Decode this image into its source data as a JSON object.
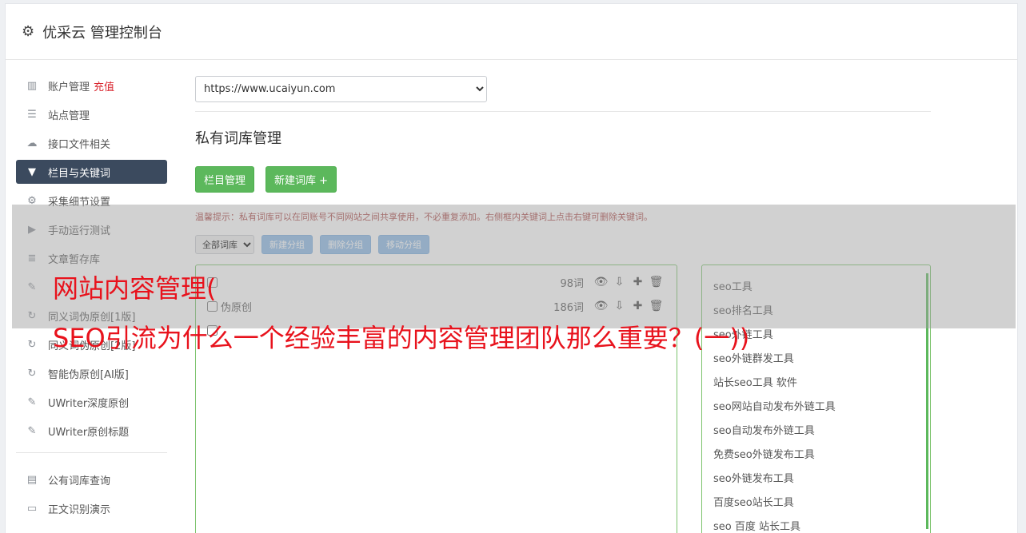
{
  "header": {
    "icon": "gear-icon",
    "title": "优采云 管理控制台"
  },
  "sidebar": {
    "items": [
      {
        "icon": "bar-chart-icon",
        "label": "账户管理",
        "extra": "充值"
      },
      {
        "icon": "server-icon",
        "label": "站点管理"
      },
      {
        "icon": "cloud-upload-icon",
        "label": "接口文件相关"
      },
      {
        "icon": "filter-icon",
        "label": "栏目与关键词",
        "active": true
      },
      {
        "icon": "cogs-icon",
        "label": "采集细节设置"
      },
      {
        "icon": "play-circle-icon",
        "label": "手动运行测试"
      },
      {
        "icon": "database-icon",
        "label": "文章暂存库"
      },
      {
        "icon": "edit-icon",
        "label": ""
      },
      {
        "icon": "refresh-icon",
        "label": "同义词伪原创[1版]"
      },
      {
        "icon": "refresh-icon",
        "label": "同义词伪原创[2版]"
      },
      {
        "icon": "refresh-icon",
        "label": "智能伪原创[AI版]"
      },
      {
        "icon": "edit-icon",
        "label": "UWriter深度原创"
      },
      {
        "icon": "edit-icon",
        "label": "UWriter原创标题"
      }
    ],
    "items2": [
      {
        "icon": "book-icon",
        "label": "公有词库查询"
      },
      {
        "icon": "monitor-icon",
        "label": "正文识别演示"
      }
    ]
  },
  "main": {
    "site_select": "https://www.ucaiyun.com",
    "section_title": "私有词库管理",
    "btn_columns": "栏目管理",
    "btn_new": "新建词库 +",
    "tip": "温馨提示：私有词库可以在同账号不同网站之间共享使用，不必重复添加。右侧框内关键词上点击右键可删除关键词。",
    "filter_select": "全部词库",
    "btn_add_group": "新建分组",
    "btn_del_group": "删除分组",
    "btn_move_group": "移动分组",
    "groups": [
      {
        "name": "",
        "count": "98词"
      },
      {
        "name": "伪原创",
        "count": "186词"
      },
      {
        "name": "",
        "count": ""
      }
    ],
    "keywords": [
      "seo工具",
      "seo排名工具",
      "seo外链工具",
      "seo外链群发工具",
      "站长seo工具 软件",
      "seo网站自动发布外链工具",
      "seo自动发布外链工具",
      "免费seo外链发布工具",
      "seo外链发布工具",
      "百度seo站长工具",
      "seo 百度 站长工具"
    ]
  },
  "overlay": {
    "line1": "网站内容管理(",
    "line2": "SEO引流为什么一个经验丰富的内容管理团队那么重要？(一))"
  },
  "colors": {
    "accent": "#5cb85c",
    "active_nav": "#3b4a5e",
    "headline": "#e8121c",
    "tip": "#a94442"
  }
}
